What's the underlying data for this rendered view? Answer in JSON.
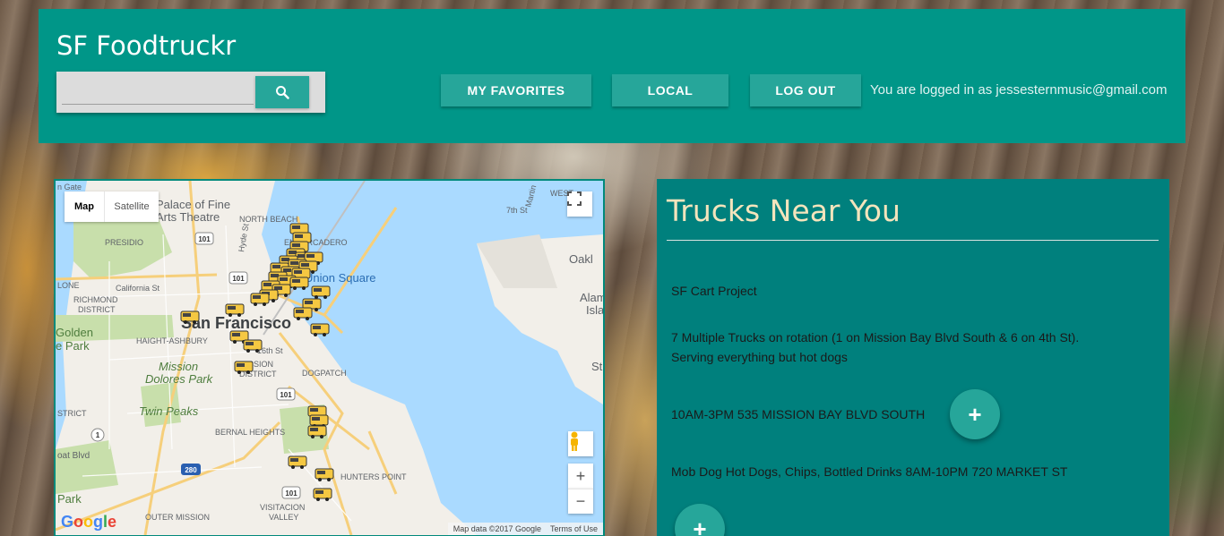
{
  "header": {
    "title": "SF Foodtruckr",
    "search": {
      "value": "",
      "placeholder": ""
    },
    "nav": {
      "favorites": "MY FAVORITES",
      "local": "LOCAL",
      "logout": "LOG OUT"
    },
    "logged_in_text": "You are logged in as jessesternmusic@gmail.com"
  },
  "map": {
    "type_buttons": {
      "map": "Map",
      "satellite": "Satellite"
    },
    "labels": {
      "palace": "Palace of Fine",
      "arts": "Arts Theatre",
      "north_beach": "NORTH BEACH",
      "embarcadero": "EMBARCADERO",
      "presidio": "PRESIDIO",
      "california": "California St",
      "richmond1": "RICHMOND",
      "richmond2": "DISTRICT",
      "lone": "LONE",
      "union_square": "Union Square",
      "san_francisco": "San Francisco",
      "haight": "HAIGHT-ASHBURY",
      "golden1": "Golden",
      "golden2": "e Park",
      "mission_dolores1": "Mission",
      "mission_dolores2": "Dolores Park",
      "mission_district1": "MISSION",
      "mission_district2": "DISTRICT",
      "dogpatch": "DOGPATCH",
      "twin_peaks": "Twin Peaks",
      "bernal": "BERNAL HEIGHTS",
      "hunters": "HUNTERS POINT",
      "visitacion1": "VISITACION",
      "visitacion2": "VALLEY",
      "outer_mission": "OUTER MISSION",
      "oakland": "Oakl",
      "alameda1": "Alam",
      "alameda2": "Isla",
      "sixteenth": "16th St",
      "seventh": "7th St",
      "hyde": "Hyde St",
      "martin": "Martin",
      "west": "WEST",
      "n_gate": "n Gate",
      "strict": "STRICT",
      "boat": "oat Blvd",
      "park": "Park",
      "st": "St",
      "highway_101": "101",
      "highway_280": "280",
      "highway_1": "1"
    },
    "footer": {
      "data": "Map data ©2017 Google",
      "terms": "Terms of Use"
    },
    "logo": "Google",
    "colors": {
      "water": "#aadaff",
      "land": "#f2efe9",
      "park": "#c8dfab",
      "road": "#f6cf7b",
      "truck": "#f5c842"
    }
  },
  "trucks_panel": {
    "title": "Trucks Near You",
    "entries": [
      {
        "name": "SF Cart Project",
        "description_line1": "7 Multiple Trucks on rotation (1 on Mission Bay Blvd South & 6 on 4th St).",
        "description_line2": "Serving everything but hot dogs",
        "hours_address": "10AM-3PM   535 MISSION BAY BLVD SOUTH"
      },
      {
        "summary": "Mob Dog   Hot Dogs, Chips, Bottled Drinks   8AM-10PM   720 MARKET ST"
      }
    ],
    "add_label": "+"
  }
}
